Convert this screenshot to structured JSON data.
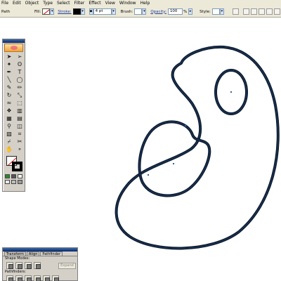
{
  "menubar": {
    "items": [
      "File",
      "Edit",
      "Object",
      "Type",
      "Select",
      "Filter",
      "Effect",
      "View",
      "Window",
      "Help"
    ]
  },
  "controlbar": {
    "selection_label": "Path",
    "fill_label": "Fill:",
    "stroke_label": "Stroke:",
    "stroke_weight": "4 pt",
    "brush_label": "Brush:",
    "opacity_label": "Opacity:",
    "opacity_value": "100",
    "opacity_unit": "%",
    "style_label": "Style:"
  },
  "pathfinder": {
    "tabs": [
      "Transform",
      "Align",
      "Pathfinder"
    ],
    "shape_modes_label": "Shape Modes:",
    "pathfinders_label": "Pathfinders:",
    "expand_label": "Expand"
  },
  "colors": {
    "stroke": "#0d1b2a",
    "stroke_inner": "#1f3b6e",
    "anchor": "#2e5eaa"
  }
}
